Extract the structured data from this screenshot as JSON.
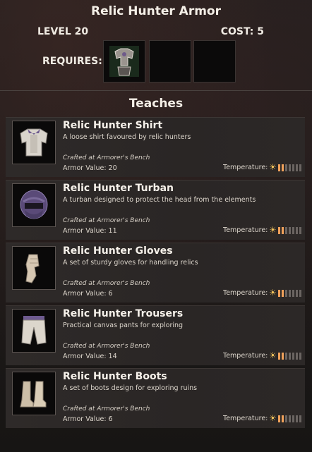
{
  "header": {
    "title": "Relic Hunter Armor",
    "level": "LEVEL 20",
    "cost": "COST: 5",
    "requires_label": "REQUIRES:",
    "required_item_icon": "relic-armor-set-icon"
  },
  "teaches_label": "Teaches",
  "items": [
    {
      "name": "Relic Hunter Shirt",
      "description": "A loose shirt favoured by relic hunters",
      "crafted": "Crafted at Armorer's Bench",
      "armor": "Armor Value: 20",
      "temperature_label": "Temperature:",
      "icon": "shirt-icon"
    },
    {
      "name": "Relic Hunter Turban",
      "description": "A turban designed to protect the head from the elements",
      "crafted": "Crafted at Armorer's Bench",
      "armor": "Armor Value: 11",
      "temperature_label": "Temperature:",
      "icon": "turban-icon"
    },
    {
      "name": "Relic Hunter Gloves",
      "description": "A set of sturdy gloves for handling relics",
      "crafted": "Crafted at Armorer's Bench",
      "armor": "Armor Value: 6",
      "temperature_label": "Temperature:",
      "icon": "gloves-icon"
    },
    {
      "name": "Relic Hunter Trousers",
      "description": "Practical canvas pants for exploring",
      "crafted": "Crafted at Armorer's Bench",
      "armor": "Armor Value: 14",
      "temperature_label": "Temperature:",
      "icon": "trousers-icon"
    },
    {
      "name": "Relic Hunter Boots",
      "description": "A set of boots design for exploring ruins",
      "crafted": "Crafted at Armorer's Bench",
      "armor": "Armor Value: 6",
      "temperature_label": "Temperature:",
      "icon": "boots-icon"
    }
  ],
  "colors": {
    "heat_active": "#f0a15a",
    "heat_inactive": "#6a6461",
    "sun": "#f1c35b"
  }
}
